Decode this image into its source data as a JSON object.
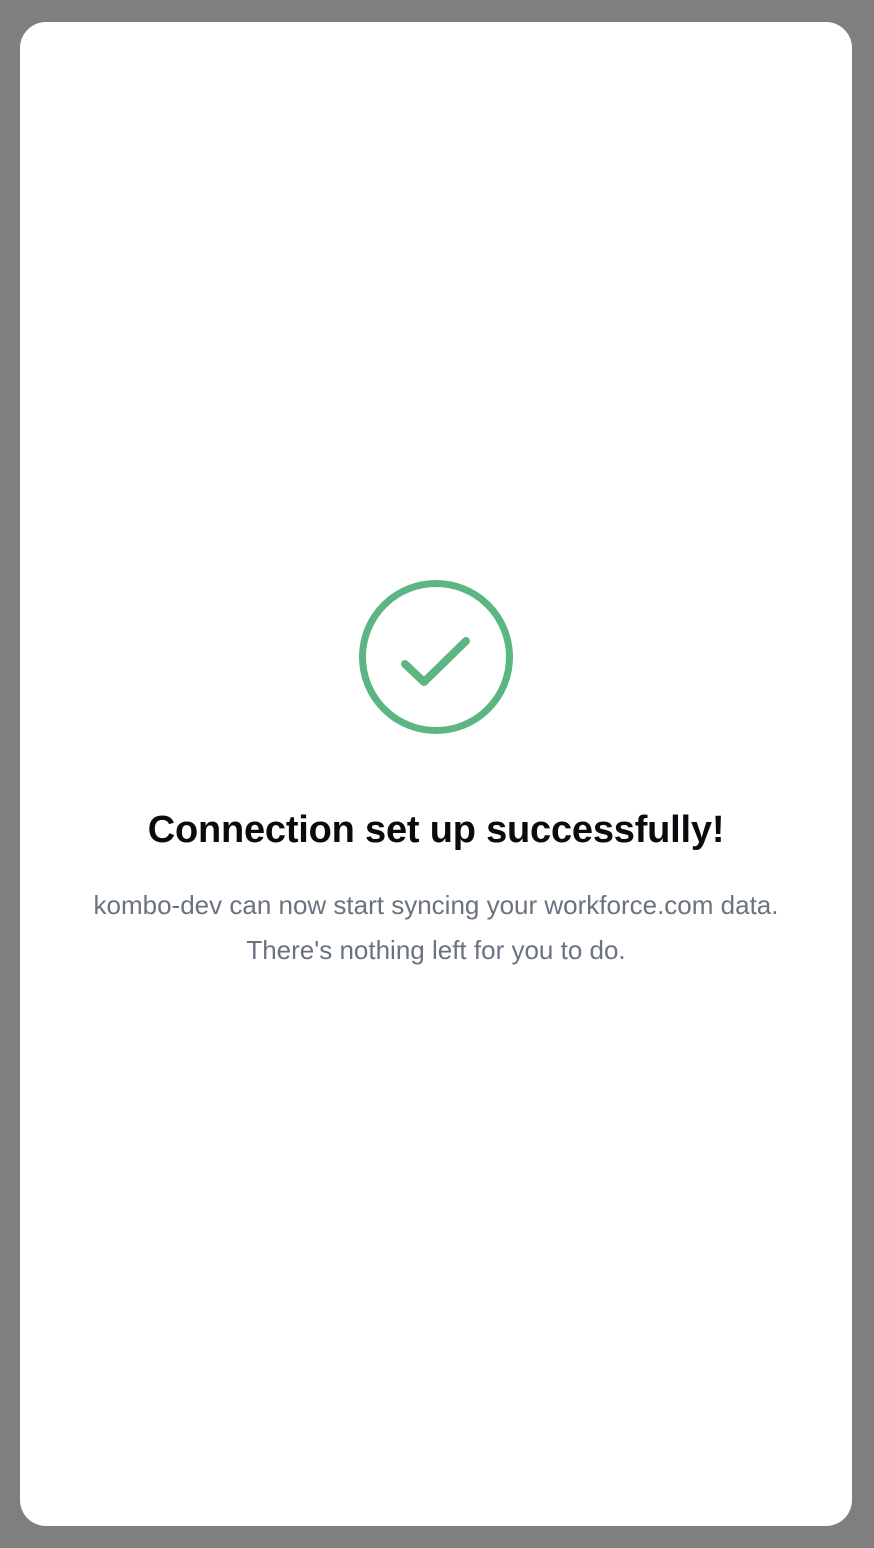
{
  "dialog": {
    "icon": "check-circle-icon",
    "title": "Connection set up successfully!",
    "message": "kombo-dev can now start syncing your workforce.com data. There's nothing left for you to do."
  },
  "colors": {
    "backdrop": "#7f7f7f",
    "dialog_background": "#ffffff",
    "success": "#5bb683",
    "title": "#0b0b0f",
    "message": "#6b7280"
  }
}
